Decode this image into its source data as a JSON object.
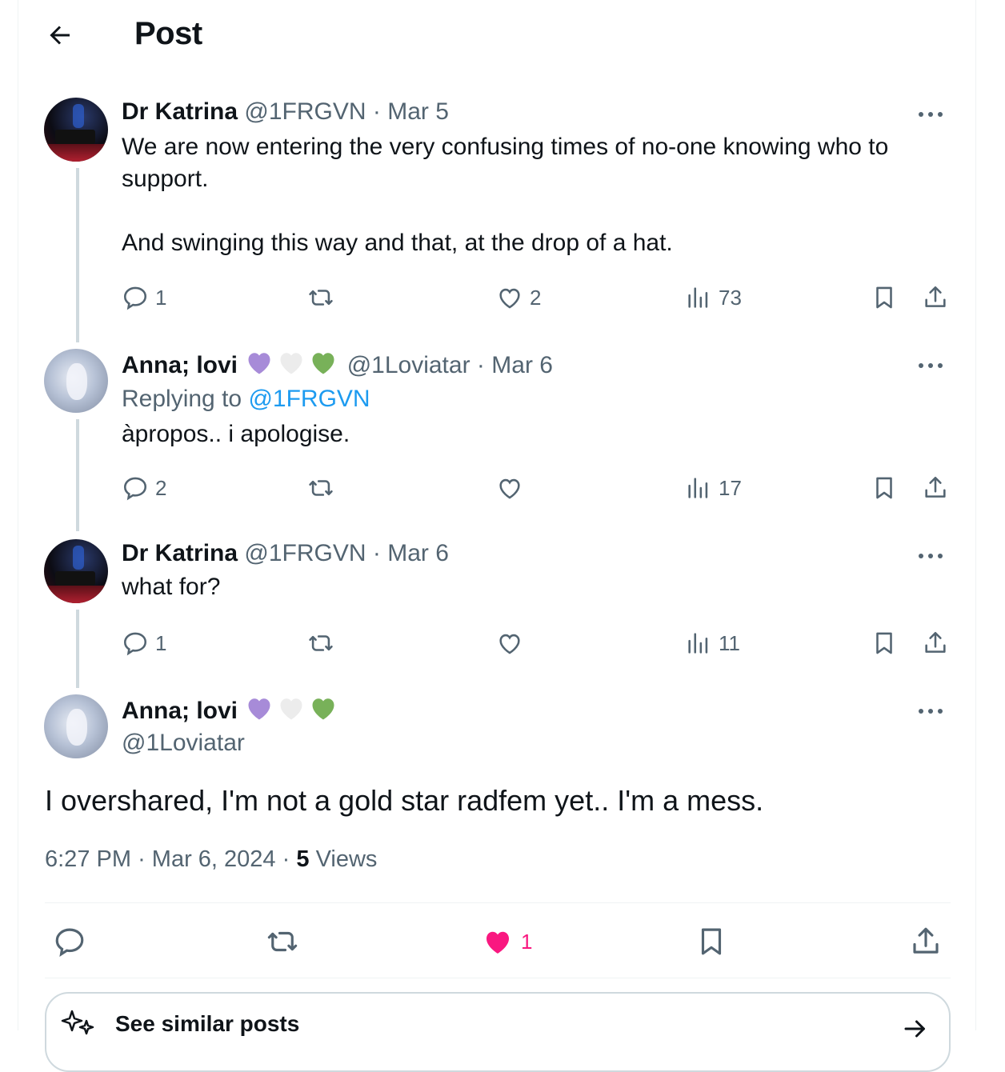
{
  "header": {
    "title": "Post"
  },
  "thread": [
    {
      "name": "Dr Katrina",
      "handle": "@1FRGVN",
      "separator": "·",
      "date": "Mar 5",
      "text_lines": [
        "We are now entering the very confusing times of no-one knowing who to",
        "support.",
        "",
        "And swinging this way and that, at the drop of a hat."
      ],
      "stats": {
        "replies": "1",
        "reposts": "",
        "likes": "2",
        "views": "73"
      }
    },
    {
      "name": "Anna; lovi",
      "emojis": [
        "purple-heart",
        "white-heart",
        "green-heart"
      ],
      "handle": "@1Loviatar",
      "separator": "·",
      "date": "Mar 6",
      "replying_prefix": "Replying to",
      "replying_handle": "@1FRGVN",
      "text": "àpropos.. i apologise.",
      "stats": {
        "replies": "2",
        "reposts": "",
        "likes": "",
        "views": "17"
      }
    },
    {
      "name": "Dr Katrina",
      "handle": "@1FRGVN",
      "separator": "·",
      "date": "Mar 6",
      "text": "what for?",
      "stats": {
        "replies": "1",
        "reposts": "",
        "likes": "",
        "views": "11"
      }
    }
  ],
  "main_post": {
    "name": "Anna; lovi",
    "emojis": [
      "purple-heart",
      "white-heart",
      "green-heart"
    ],
    "handle": "@1Loviatar",
    "text": "I overshared, I'm not a gold star radfem yet.. I'm a mess.",
    "time": "6:27 PM",
    "separator": "·",
    "date": "Mar 6, 2024",
    "views_count": "5",
    "views_label": "Views",
    "likes": "1"
  },
  "similar": {
    "label": "See similar posts"
  },
  "colors": {
    "like_pink": "#f91880",
    "link_blue": "#1d9bf0",
    "muted": "#536471",
    "thread_line": "#cfd9de"
  },
  "icons": [
    "back-arrow-icon",
    "more-icon",
    "reply-icon",
    "repost-icon",
    "like-icon",
    "views-icon",
    "bookmark-icon",
    "share-icon",
    "sparkle-icon",
    "arrow-right-icon"
  ]
}
